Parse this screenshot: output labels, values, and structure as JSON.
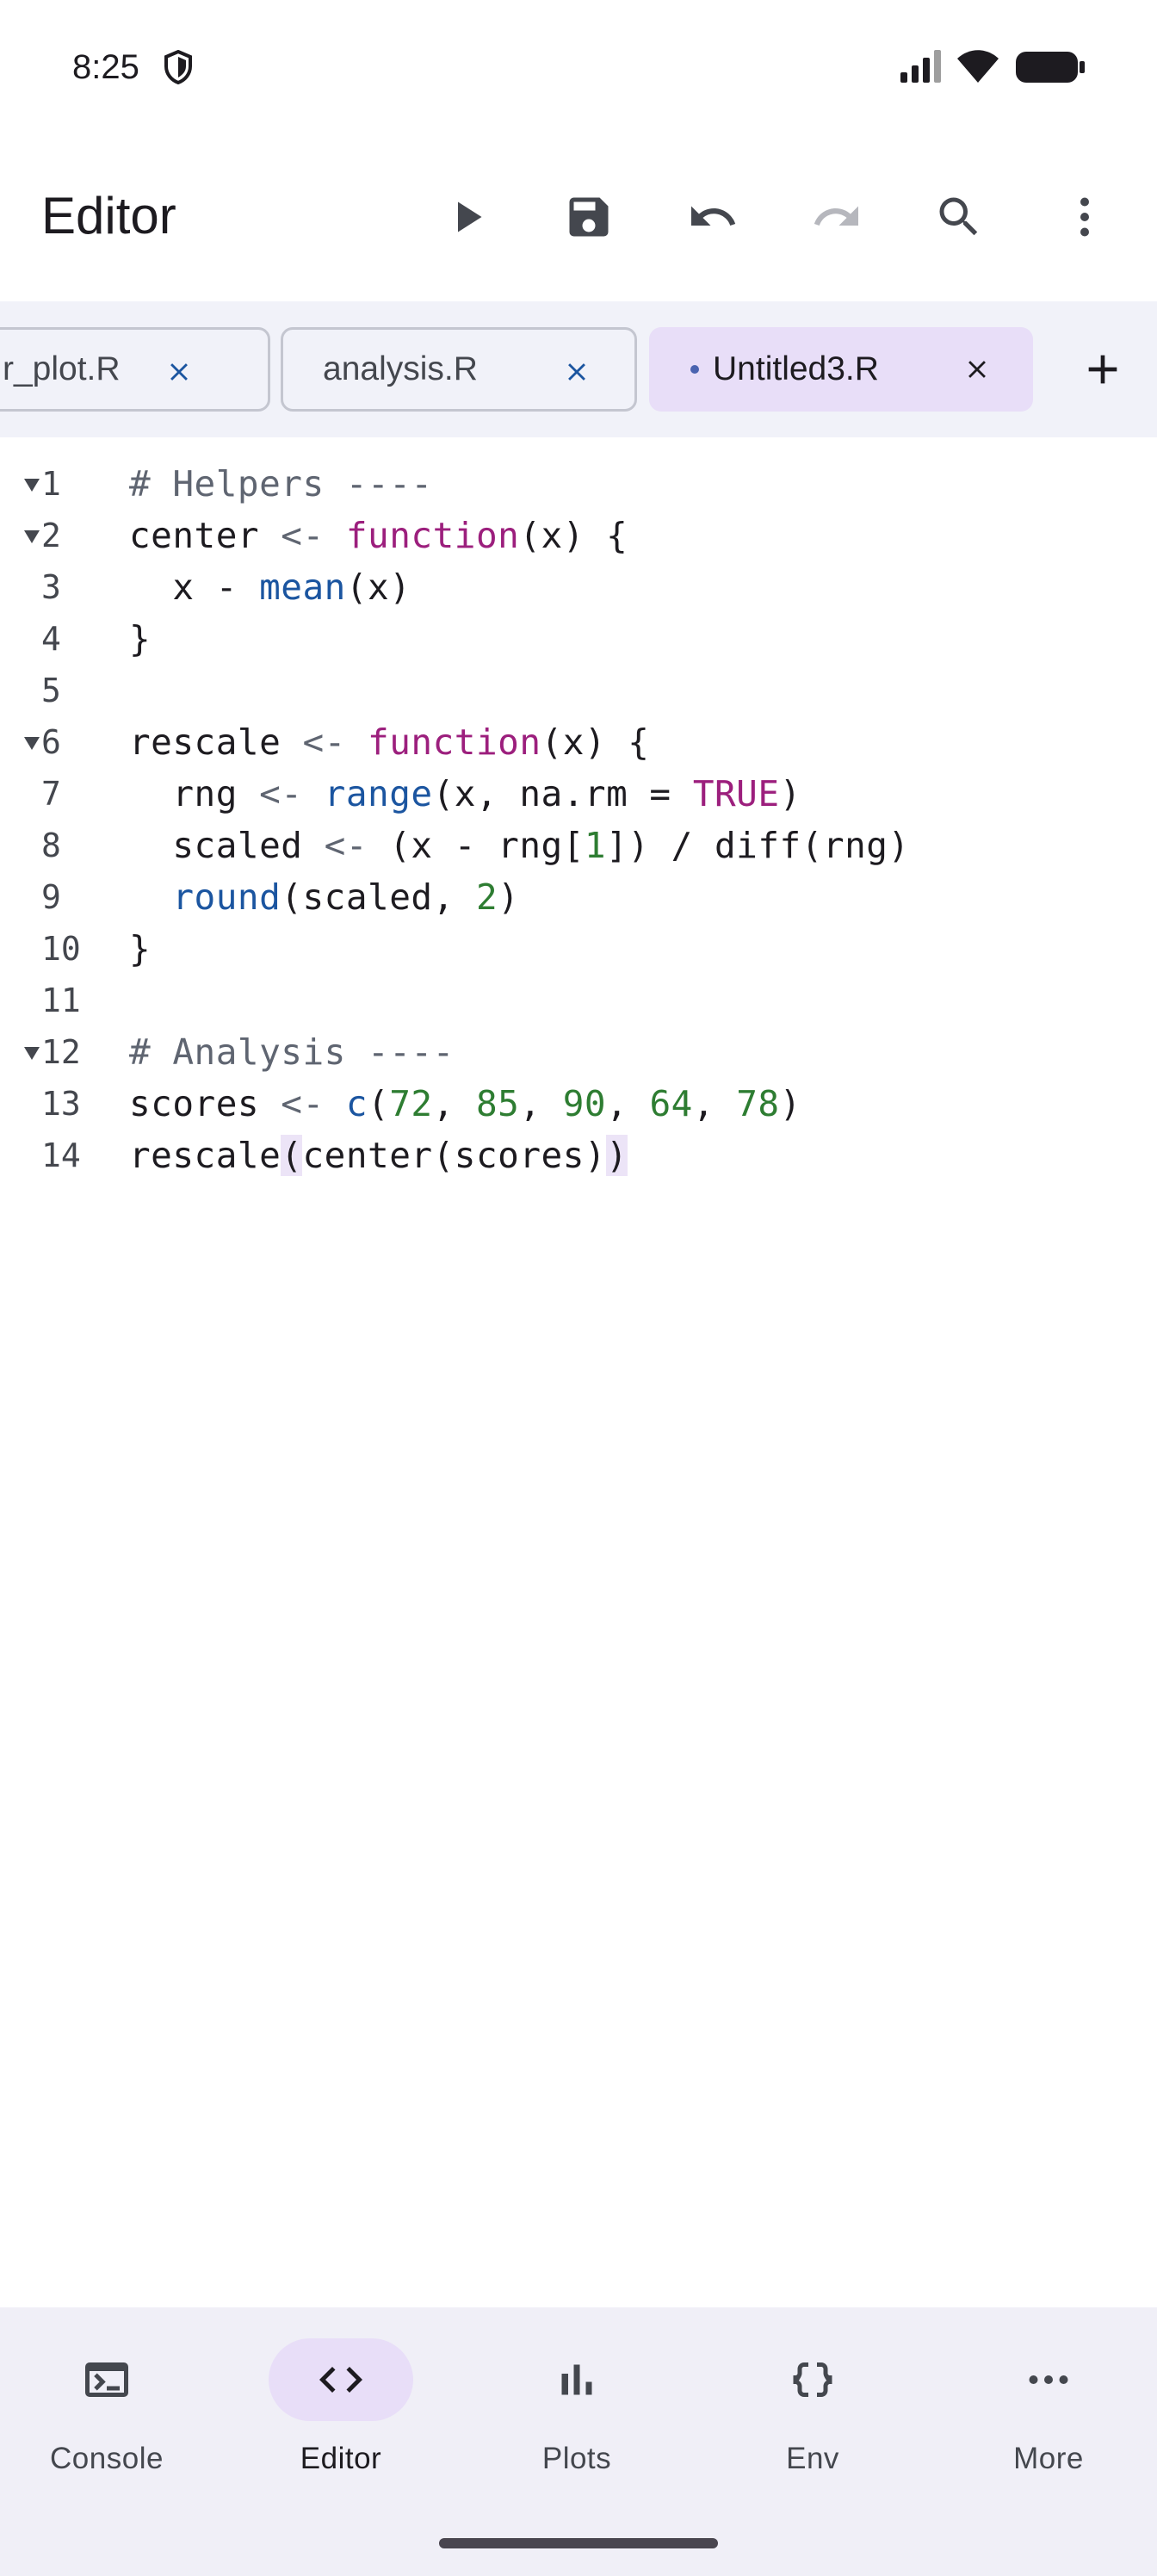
{
  "status": {
    "time": "8:25"
  },
  "app_bar": {
    "title": "Editor",
    "actions": [
      "run-icon",
      "save-icon",
      "undo-icon",
      "redo-icon",
      "search-icon",
      "more-vert-icon"
    ]
  },
  "tabs": [
    {
      "label": "r_plot.R",
      "active": false,
      "modified": false
    },
    {
      "label": "analysis.R",
      "active": false,
      "modified": false
    },
    {
      "label": "Untitled3.R",
      "active": true,
      "modified": true
    }
  ],
  "editor": {
    "lines": [
      {
        "number": "1",
        "foldable": true
      },
      {
        "number": "2",
        "foldable": true
      },
      {
        "number": "3",
        "foldable": false
      },
      {
        "number": "4",
        "foldable": false
      },
      {
        "number": "5",
        "foldable": false
      },
      {
        "number": "6",
        "foldable": true
      },
      {
        "number": "7",
        "foldable": false
      },
      {
        "number": "8",
        "foldable": false
      },
      {
        "number": "9",
        "foldable": false
      },
      {
        "number": "10",
        "foldable": false
      },
      {
        "number": "11",
        "foldable": false
      },
      {
        "number": "12",
        "foldable": true
      },
      {
        "number": "13",
        "foldable": false
      },
      {
        "number": "14",
        "foldable": false
      }
    ],
    "code": {
      "l1": "# Helpers ----",
      "l2_a": "center ",
      "l2_b": "<-",
      "l2_c": " ",
      "l2_d": "function",
      "l2_e": "(x) {",
      "l3_a": "  x - ",
      "l3_b": "mean",
      "l3_c": "(x)",
      "l4": "}",
      "l5": "",
      "l6_a": "rescale ",
      "l6_b": "<-",
      "l6_c": " ",
      "l6_d": "function",
      "l6_e": "(x) {",
      "l7_a": "  rng ",
      "l7_b": "<-",
      "l7_c": " ",
      "l7_d": "range",
      "l7_e": "(x, na.rm = ",
      "l7_f": "TRUE",
      "l7_g": ")",
      "l8_a": "  scaled ",
      "l8_b": "<-",
      "l8_c": " (x - rng[",
      "l8_d": "1",
      "l8_e": "]) / diff(rng)",
      "l9_a": "  ",
      "l9_b": "round",
      "l9_c": "(scaled, ",
      "l9_d": "2",
      "l9_e": ")",
      "l10": "}",
      "l11": "",
      "l12": "# Analysis ----",
      "l13_a": "scores ",
      "l13_b": "<-",
      "l13_c": " ",
      "l13_d": "c",
      "l13_e": "(",
      "l13_n1": "72",
      "l13_n2": "85",
      "l13_n3": "90",
      "l13_n4": "64",
      "l13_n5": "78",
      "l13_sep": ", ",
      "l13_end": ")",
      "l14_a": "rescale",
      "l14_b": "(",
      "l14_c": "center(scores)",
      "l14_d": ")"
    }
  },
  "bottom_nav": [
    {
      "label": "Console",
      "icon": "terminal-icon",
      "active": false
    },
    {
      "label": "Editor",
      "icon": "code-icon",
      "active": true
    },
    {
      "label": "Plots",
      "icon": "bar-chart-icon",
      "active": false
    },
    {
      "label": "Env",
      "icon": "braces-icon",
      "active": false
    },
    {
      "label": "More",
      "icon": "more-horiz-icon",
      "active": false
    }
  ],
  "colors": {
    "accent_container": "#e8def8",
    "tab_strip_bg": "#f1f2f9",
    "keyword": "#9c1f7d",
    "function": "#1b55a0",
    "number": "#2e7d32",
    "comment": "#5f6571",
    "close_blue": "#1b55a0"
  }
}
